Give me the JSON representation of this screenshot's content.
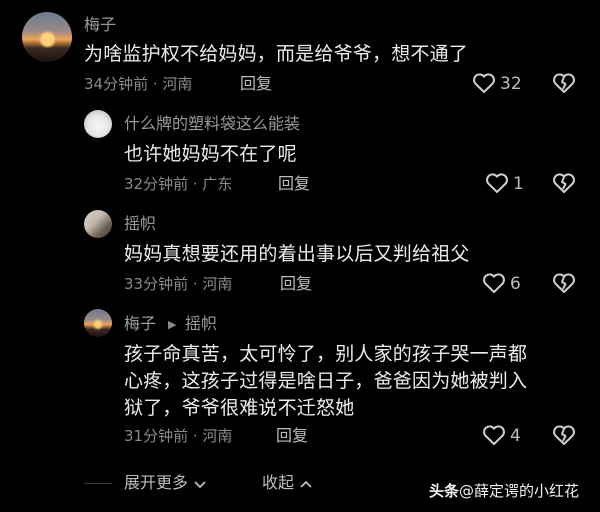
{
  "comments": [
    {
      "author": "梅子",
      "text": "为啥监护权不给妈妈，而是给爷爷，想不通了",
      "time_location": "34分钟前 · 河南",
      "reply_label": "回复",
      "likes": "32"
    },
    {
      "author": "什么牌的塑料袋这么能装",
      "text": "也许她妈妈不在了呢",
      "time_location": "32分钟前 · 广东",
      "reply_label": "回复",
      "likes": "1"
    },
    {
      "author": "摇帜",
      "text": "妈妈真想要还用的着出事以后又判给祖父",
      "time_location": "33分钟前 · 河南",
      "reply_label": "回复",
      "likes": "6"
    },
    {
      "author": "梅子",
      "reply_to": "摇帜",
      "text_lines": [
        "孩子命真苦，太可怜了，别人家的孩子哭一声都",
        "心疼，这孩子过得是啥日子，爸爸因为她被判入",
        "狱了，爷爷很难说不迁怒她"
      ],
      "time_location": "31分钟前 · 河南",
      "reply_label": "回复",
      "likes": "4"
    }
  ],
  "footer": {
    "expand_label": "展开更多",
    "collapse_label": "收起"
  },
  "watermark": {
    "brand": "头条",
    "account": "@薛定谔的小红花"
  },
  "icons": {
    "like": "heart-outline-icon",
    "dislike": "broken-heart-icon",
    "expand": "chevron-down-icon",
    "collapse": "chevron-up-icon",
    "reply_arrow": "triangle-right-icon"
  }
}
